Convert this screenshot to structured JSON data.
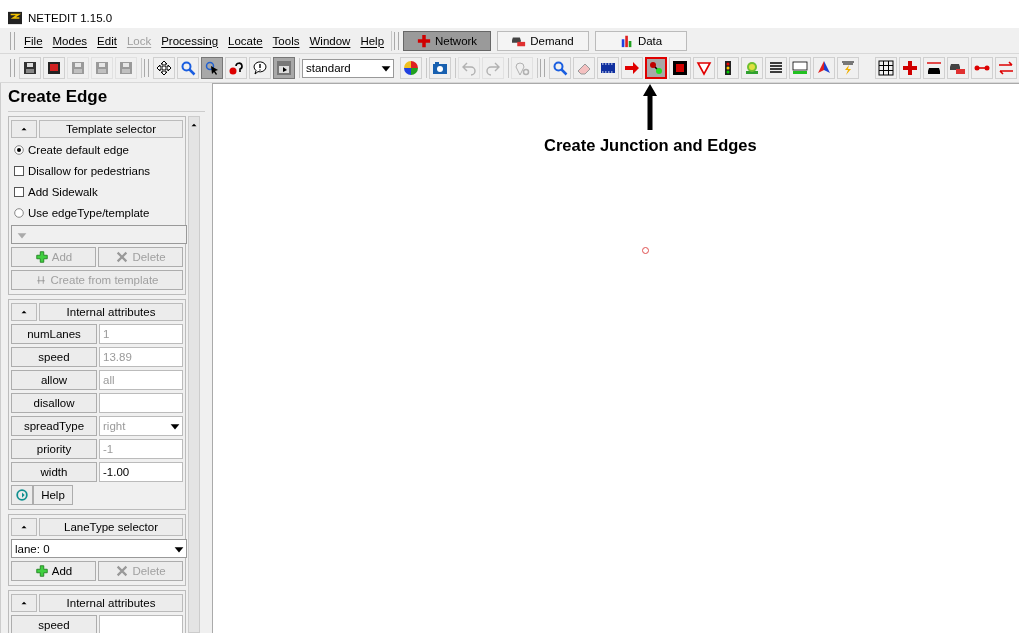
{
  "window": {
    "title": "NETEDIT 1.15.0"
  },
  "menu": [
    {
      "label": "File",
      "disabled": false
    },
    {
      "label": "Modes",
      "disabled": false
    },
    {
      "label": "Edit",
      "disabled": false
    },
    {
      "label": "Lock",
      "disabled": true
    },
    {
      "label": "Processing",
      "disabled": false
    },
    {
      "label": "Locate",
      "disabled": false
    },
    {
      "label": "Tools",
      "disabled": false
    },
    {
      "label": "Window",
      "disabled": false
    },
    {
      "label": "Help",
      "disabled": false
    }
  ],
  "supermodes": [
    {
      "label": "Network",
      "selected": true
    },
    {
      "label": "Demand",
      "selected": false
    },
    {
      "label": "Data",
      "selected": false
    }
  ],
  "toolbar": {
    "file_tools": [
      {
        "kind": "floppy",
        "disabled": false
      },
      {
        "kind": "record-floppy",
        "disabled": false
      },
      {
        "kind": "floppy",
        "disabled": true
      },
      {
        "kind": "floppy",
        "disabled": true
      },
      {
        "kind": "floppy",
        "disabled": true
      }
    ],
    "view_tools": [
      {
        "kind": "move",
        "selected": false
      },
      {
        "kind": "magnifier",
        "selected": false
      },
      {
        "kind": "pointer",
        "selected": true
      },
      {
        "kind": "question",
        "selected": false
      },
      {
        "kind": "speech",
        "selected": false
      },
      {
        "kind": "menu",
        "selected": true
      }
    ],
    "scheme": {
      "value": "standard"
    },
    "misc_tools": [
      {
        "kind": "color-wheel",
        "disabled": false
      },
      {
        "kind": "camera",
        "disabled": false
      },
      {
        "kind": "undo",
        "disabled": true
      },
      {
        "kind": "redo",
        "disabled": true
      },
      {
        "kind": "pin-gear",
        "disabled": true
      }
    ],
    "edit_modes": [
      {
        "kind": "magnifier",
        "selected": false,
        "highlighted": false
      },
      {
        "kind": "eraser",
        "selected": false,
        "highlighted": false
      },
      {
        "kind": "film",
        "selected": false,
        "highlighted": false
      },
      {
        "kind": "arrow",
        "selected": false,
        "highlighted": false
      },
      {
        "kind": "node-link",
        "selected": true,
        "highlighted": true
      },
      {
        "kind": "junction",
        "selected": false,
        "highlighted": false
      },
      {
        "kind": "triangle",
        "selected": false,
        "highlighted": false
      },
      {
        "kind": "traffic-light",
        "selected": false,
        "highlighted": false
      },
      {
        "kind": "stop",
        "selected": false,
        "highlighted": false
      },
      {
        "kind": "lines",
        "selected": false,
        "highlighted": false
      },
      {
        "kind": "taz",
        "selected": false,
        "highlighted": false
      },
      {
        "kind": "polygon",
        "selected": false,
        "highlighted": false
      },
      {
        "kind": "lightning",
        "selected": false,
        "highlighted": false
      }
    ],
    "extra_modes": [
      {
        "kind": "grid"
      },
      {
        "kind": "cross"
      },
      {
        "kind": "car-arrows"
      },
      {
        "kind": "cars"
      },
      {
        "kind": "dots-line"
      },
      {
        "kind": "swap"
      }
    ]
  },
  "panel": {
    "title": "Create Edge",
    "sections": [
      {
        "title": "Template selector",
        "items": [
          {
            "kind": "radio",
            "label": "Create default edge",
            "checked": true
          },
          {
            "kind": "checkbox",
            "label": "Disallow for pedestrians",
            "checked": false
          },
          {
            "kind": "checkbox",
            "label": "Add Sidewalk",
            "checked": false
          },
          {
            "kind": "radio",
            "label": "Use edgeType/template",
            "checked": false
          },
          {
            "kind": "combo",
            "disabled": true
          },
          {
            "kind": "button-pair",
            "buttons": [
              {
                "label": "Add",
                "disabled": true
              },
              {
                "label": "Delete",
                "disabled": true
              }
            ]
          },
          {
            "kind": "wide-button",
            "label": "Create from template",
            "disabled": true
          }
        ]
      },
      {
        "title": "Internal attributes",
        "items": [
          {
            "kind": "attribute",
            "label": "numLanes",
            "value": "1",
            "disabled": true
          },
          {
            "kind": "attribute",
            "label": "speed",
            "value": "13.89",
            "disabled": true
          },
          {
            "kind": "attribute",
            "label": "allow",
            "value": "all",
            "disabled": true
          },
          {
            "kind": "attribute",
            "label": "disallow"
          },
          {
            "kind": "attribute-combo",
            "label": "spreadType",
            "value": "right",
            "disabled": true
          },
          {
            "kind": "attribute",
            "label": "priority",
            "value": "-1",
            "disabled": true
          },
          {
            "kind": "attribute",
            "label": "width",
            "value": "-1.00",
            "disabled": false
          },
          {
            "kind": "help",
            "label": "Help"
          }
        ]
      },
      {
        "title": "LaneType selector",
        "items": [
          {
            "kind": "combo",
            "value": "lane: 0",
            "disabled": false
          },
          {
            "kind": "button-pair",
            "buttons": [
              {
                "label": "Add",
                "disabled": false
              },
              {
                "label": "Delete",
                "disabled": true
              }
            ]
          }
        ]
      },
      {
        "title": "Internal attributes",
        "items": [
          {
            "kind": "attribute",
            "label": "speed"
          }
        ]
      }
    ]
  },
  "annotation": {
    "label": "Create Junction and Edges"
  }
}
